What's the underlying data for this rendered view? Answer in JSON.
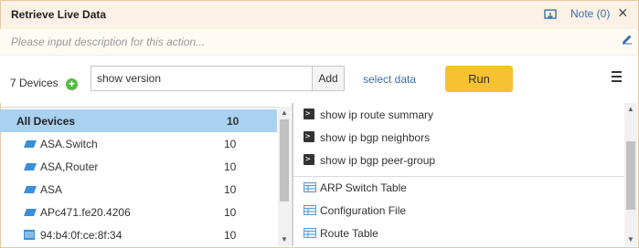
{
  "header": {
    "title": "Retrieve Live Data",
    "note_label": "Note (0)",
    "close_glyph": "×"
  },
  "description": {
    "placeholder": "Please input description for this action..."
  },
  "toolbar": {
    "device_count": "7 Devices",
    "command_value": "show version",
    "add_label": "Add",
    "select_data_label": "select data",
    "run_label": "Run"
  },
  "devices": {
    "header": {
      "name": "All Devices",
      "count": "10"
    },
    "items": [
      {
        "name": "ASA.Switch",
        "count": "10",
        "icon": "switch-icon"
      },
      {
        "name": "ASA,Router",
        "count": "10",
        "icon": "switch-icon"
      },
      {
        "name": "ASA",
        "count": "10",
        "icon": "switch-icon"
      },
      {
        "name": "APc471.fe20.4206",
        "count": "10",
        "icon": "switch-icon"
      },
      {
        "name": "94:b4:0f:ce:8f:34",
        "count": "10",
        "icon": "server-icon"
      }
    ]
  },
  "commands": [
    {
      "name": "show ip route summary",
      "icon": "terminal-icon"
    },
    {
      "name": "show ip bgp neighbors",
      "icon": "terminal-icon"
    },
    {
      "name": "show ip bgp peer-group",
      "icon": "terminal-icon"
    }
  ],
  "tables": [
    {
      "name": "ARP Switch Table",
      "icon": "table-icon"
    },
    {
      "name": "Configuration File",
      "icon": "table-icon"
    },
    {
      "name": "Route Table",
      "icon": "table-icon"
    }
  ],
  "colors": {
    "header_bg": "#fbf1e4",
    "selected_row": "#a9d1f0",
    "run_button": "#f6c233",
    "link": "#3a6fb0",
    "add_device": "#58b947"
  }
}
